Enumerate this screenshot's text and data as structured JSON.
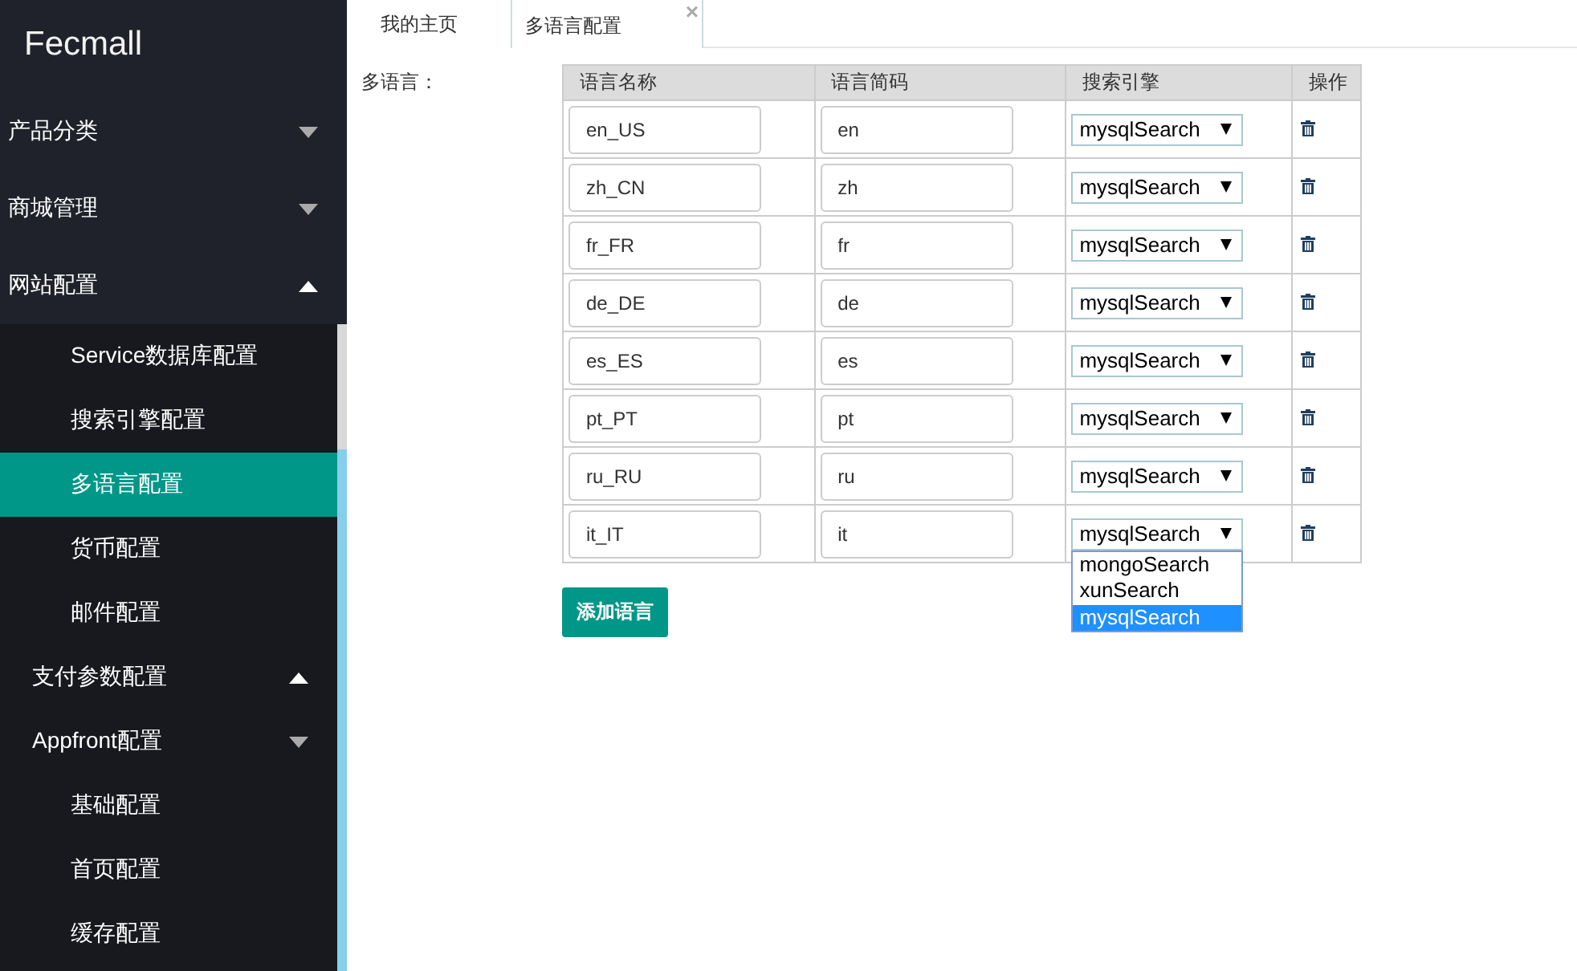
{
  "sidebar": {
    "logo": "Fecmall",
    "items": [
      {
        "label": "产品分类",
        "expanded": false
      },
      {
        "label": "商城管理",
        "expanded": false
      },
      {
        "label": "网站配置",
        "expanded": true,
        "children": [
          {
            "label": "Service数据库配置",
            "selected": false
          },
          {
            "label": "搜索引擎配置",
            "selected": false
          },
          {
            "label": "多语言配置",
            "selected": true
          },
          {
            "label": "货币配置",
            "selected": false
          },
          {
            "label": "邮件配置",
            "selected": false
          },
          {
            "label": "支付参数配置",
            "selected": false,
            "expanded": true
          },
          {
            "label": "Appfront配置",
            "selected": false,
            "expanded": false,
            "children": [
              {
                "label": "基础配置",
                "selected": false
              },
              {
                "label": "首页配置",
                "selected": false
              },
              {
                "label": "缓存配置",
                "selected": false
              }
            ]
          }
        ]
      }
    ]
  },
  "tabs": [
    {
      "label": "我的主页",
      "selected": false
    },
    {
      "label": "多语言配置",
      "selected": true,
      "close": "×"
    }
  ],
  "form": {
    "label": "多语言：",
    "table": {
      "columns": [
        "语言名称",
        "语言简码",
        "搜索引擎",
        "操作"
      ],
      "rows": [
        {
          "name": "en_US",
          "code": "en",
          "engine": "mysqlSearch",
          "open": false
        },
        {
          "name": "zh_CN",
          "code": "zh",
          "engine": "mysqlSearch",
          "open": false
        },
        {
          "name": "fr_FR",
          "code": "fr",
          "engine": "mysqlSearch",
          "open": false
        },
        {
          "name": "de_DE",
          "code": "de",
          "engine": "mysqlSearch",
          "open": false
        },
        {
          "name": "es_ES",
          "code": "es",
          "engine": "mysqlSearch",
          "open": false
        },
        {
          "name": "pt_PT",
          "code": "pt",
          "engine": "mysqlSearch",
          "open": false
        },
        {
          "name": "ru_RU",
          "code": "ru",
          "engine": "mysqlSearch",
          "open": false
        },
        {
          "name": "it_IT",
          "code": "it",
          "engine": "mysqlSearch",
          "open": true
        }
      ]
    },
    "engine_options": [
      {
        "label": "mongoSearch",
        "selected": false
      },
      {
        "label": "xunSearch",
        "selected": false
      },
      {
        "label": "mysqlSearch",
        "selected": true
      }
    ],
    "add_button": "添加语言"
  }
}
